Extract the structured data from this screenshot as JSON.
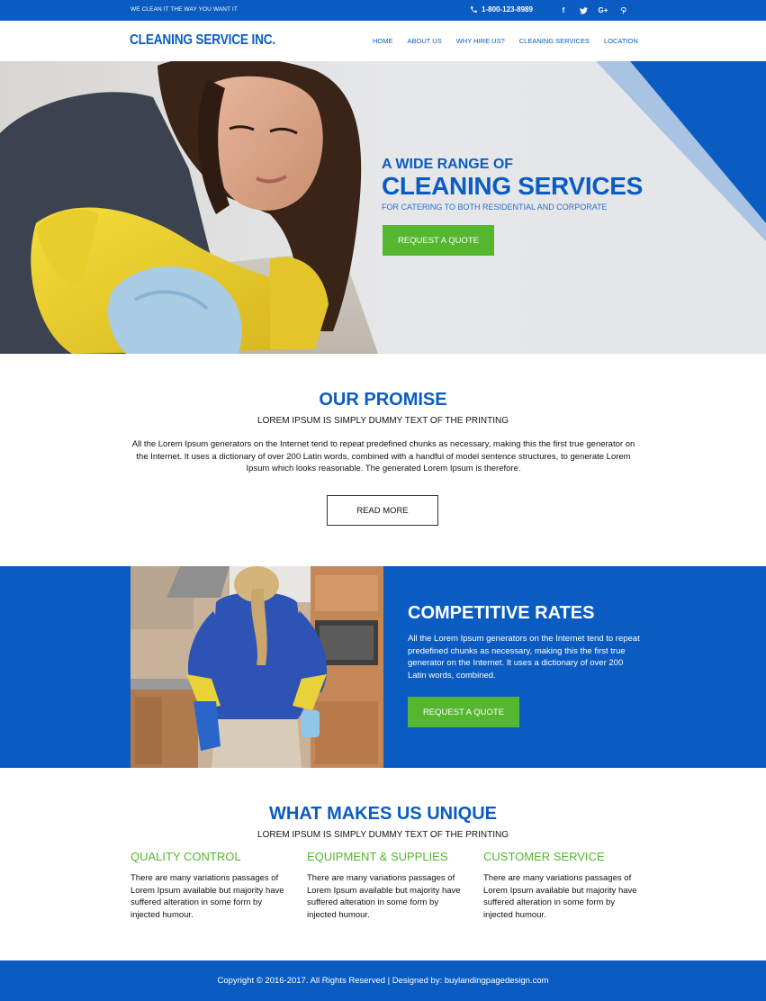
{
  "topbar": {
    "tagline": "WE CLEAN IT THE WAY YOU WANT IT",
    "phone": "1-800-123-8989",
    "social": [
      {
        "icon": "facebook-icon",
        "glyph": "f"
      },
      {
        "icon": "twitter-icon",
        "glyph": "🐦"
      },
      {
        "icon": "google-plus-icon",
        "glyph": "G+"
      },
      {
        "icon": "pinterest-icon",
        "glyph": "℗"
      }
    ]
  },
  "header": {
    "brand": "CLEANING SERVICE INC.",
    "nav": [
      "HOME",
      "ABOUT US",
      "WHY HIRE US?",
      "CLEANING SERVICES",
      "LOCATION"
    ]
  },
  "hero": {
    "subtitle": "A WIDE RANGE OF",
    "title": "CLEANING SERVICES",
    "tagline": "FOR CATERING TO BOTH RESIDENTIAL AND CORPORATE",
    "button": "REQUEST A QUOTE"
  },
  "promise": {
    "title": "OUR PROMISE",
    "subtitle": "LOREM IPSUM IS SIMPLY DUMMY TEXT OF THE PRINTING",
    "text": "All the Lorem Ipsum generators on the Internet tend to repeat predefined chunks as necessary, making this the first true generator on the Internet. It uses a dictionary of over 200 Latin words, combined with a handful of model sentence structures, to generate Lorem Ipsum which looks reasonable. The generated Lorem Ipsum is therefore.",
    "button": "READ MORE"
  },
  "rates": {
    "title": "COMPETITIVE RATES",
    "text": "All the Lorem Ipsum generators on the Internet tend to repeat predefined chunks as necessary, making this the first true generator on the Internet. It uses a dictionary of over 200 Latin words, combined.",
    "button": "REQUEST A QUOTE"
  },
  "unique": {
    "title": "WHAT MAKES US UNIQUE",
    "subtitle": "LOREM IPSUM IS SIMPLY DUMMY TEXT OF THE PRINTING",
    "features": [
      {
        "title": "QUALITY CONTROL",
        "text": "There are many variations passages of Lorem Ipsum available but majority have suffered alteration in some form by injected humour."
      },
      {
        "title": "EQUIPMENT & SUPPLIES",
        "text": "There are many variations passages of Lorem Ipsum available but majority have suffered alteration in some form by injected humour."
      },
      {
        "title": "CUSTOMER SERVICE",
        "text": "There are many variations passages of Lorem Ipsum available but majority have suffered alteration in some form by injected humour."
      }
    ]
  },
  "footer": {
    "text": "Copyright © 2016-2017. All Rights Reserved  |  Designed by: buylandingpagedesign.com"
  },
  "colors": {
    "brand_blue": "#0a5cc2",
    "accent_green": "#55b72f"
  }
}
